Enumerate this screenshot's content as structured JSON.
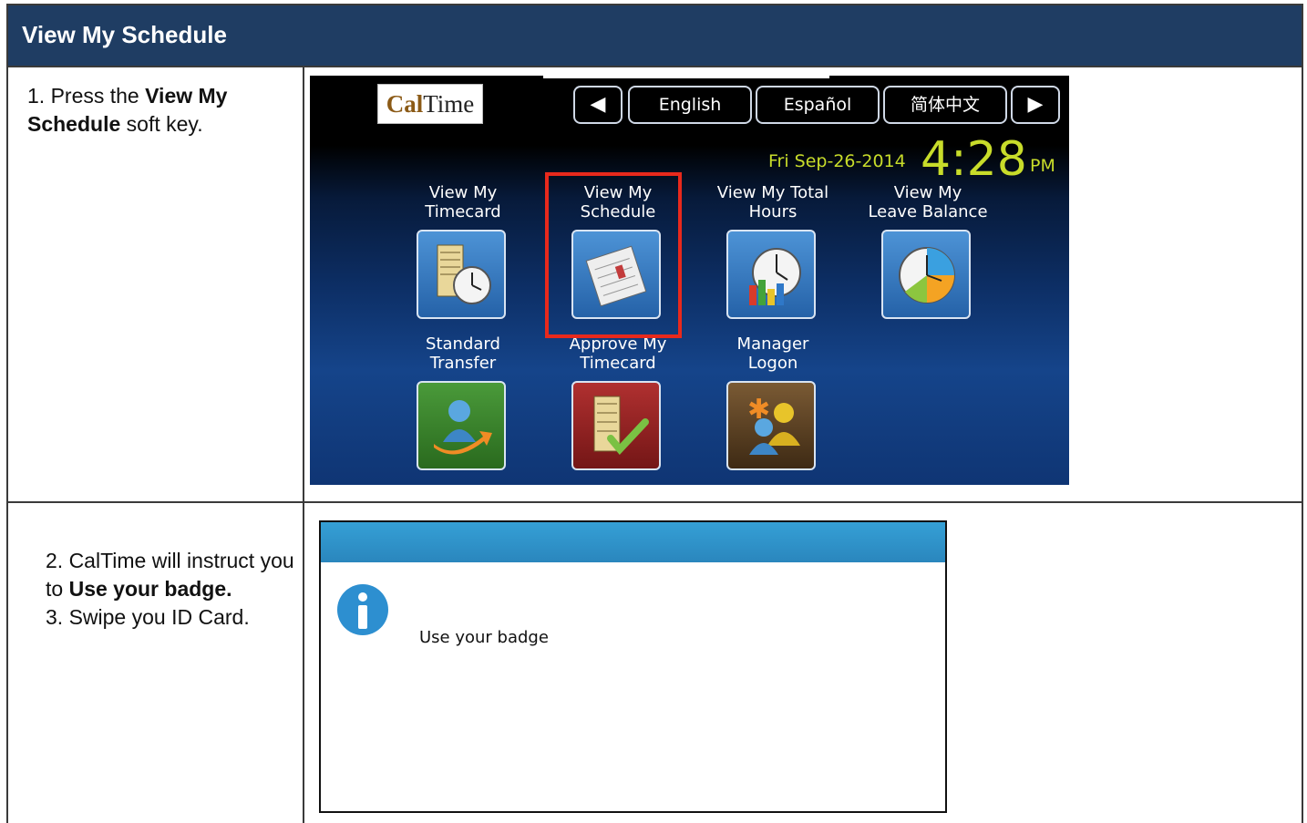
{
  "header": {
    "title": "View My Schedule"
  },
  "steps": [
    {
      "prefix": "1. Press the ",
      "bold": "View My Schedule",
      "suffix": " soft key."
    },
    {
      "line1_prefix": "2. CalTime will instruct you to ",
      "line1_bold": "Use your badge.",
      "line2": "3. Swipe you ID Card."
    }
  ],
  "kiosk": {
    "logo": {
      "part1": "Cal",
      "part2": "Time"
    },
    "nav": {
      "prev_icon": "arrow-left-icon",
      "languages": [
        "English",
        "Español",
        "简体中文"
      ],
      "next_icon": "arrow-right-icon"
    },
    "date": "Fri Sep-26-2014",
    "time": "4:28",
    "ampm": "PM",
    "accent_color": "#c8dc2a",
    "tiles": [
      {
        "label_line1": "View My",
        "label_line2": "Timecard",
        "icon": "timecard-clock-icon",
        "color": "blue"
      },
      {
        "label_line1": "View My",
        "label_line2": "Schedule",
        "icon": "schedule-planner-icon",
        "color": "blue",
        "highlighted": true
      },
      {
        "label_line1": "View My Total",
        "label_line2": "Hours",
        "icon": "clock-chart-icon",
        "color": "blue"
      },
      {
        "label_line1": "View My",
        "label_line2": "Leave Balance",
        "icon": "pie-clock-icon",
        "color": "blue"
      },
      {
        "label_line1": "Standard",
        "label_line2": "Transfer",
        "icon": "user-transfer-icon",
        "color": "green"
      },
      {
        "label_line1": "Approve My",
        "label_line2": "Timecard",
        "icon": "timecard-approve-icon",
        "color": "red"
      },
      {
        "label_line1": "Manager",
        "label_line2": "Logon",
        "icon": "manager-users-icon",
        "color": "brown"
      }
    ],
    "highlight_color": "#e8291c"
  },
  "dialog": {
    "icon": "info-icon",
    "message": "Use your badge"
  }
}
